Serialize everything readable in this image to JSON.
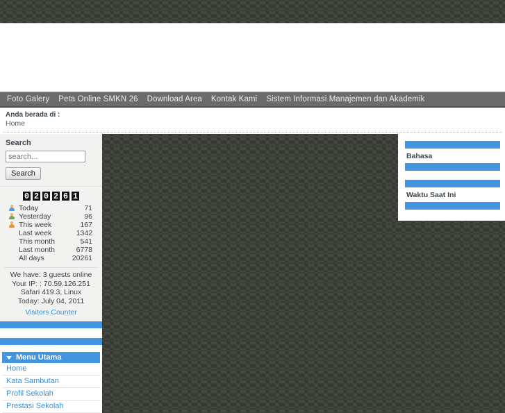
{
  "site": {
    "background_color": "#3b3e37",
    "accent_color": "#4295dd",
    "link_color": "#3d8fd1"
  },
  "topnav": {
    "items": [
      {
        "label": "Foto Galery"
      },
      {
        "label": "Peta Online SMKN 26"
      },
      {
        "label": "Download Area"
      },
      {
        "label": "Kontak Kami"
      },
      {
        "label": "Sistem Informasi Manajemen dan Akademik"
      }
    ]
  },
  "breadcrumb": {
    "title": "Anda berada di :",
    "path": "Home"
  },
  "search": {
    "label": "Search",
    "placeholder": "search...",
    "value": "",
    "button_label": "Search"
  },
  "counter": {
    "digits": [
      "0",
      "2",
      "0",
      "2",
      "6",
      "1"
    ],
    "stats": [
      {
        "icon": "person-icon-blue",
        "color": "#5b9bd5",
        "label": "Today",
        "value": "71"
      },
      {
        "icon": "person-icon-green",
        "color": "#6aa84f",
        "label": "Yesterday",
        "value": "96"
      },
      {
        "icon": "person-icon-orange",
        "color": "#e8922a",
        "label": "This week",
        "value": "167"
      },
      {
        "icon": "",
        "color": "",
        "label": "Last week",
        "value": "1342"
      },
      {
        "icon": "",
        "color": "",
        "label": "This month",
        "value": "541"
      },
      {
        "icon": "",
        "color": "",
        "label": "Last month",
        "value": "6778"
      },
      {
        "icon": "",
        "color": "",
        "label": "All days",
        "value": "20261"
      }
    ],
    "info": {
      "guests": "We have: 3 guests online",
      "ip": "Your IP: : 70.59.126.251",
      "agent": "Safari 419.3, Linux",
      "today": "Today: July 04, 2011"
    },
    "link_label": "Visitors Counter"
  },
  "mainmenu": {
    "title": "Menu Utama",
    "items": [
      {
        "label": "Home"
      },
      {
        "label": "Kata Sambutan"
      },
      {
        "label": "Profil Sekolah"
      },
      {
        "label": "Prestasi Sekolah"
      }
    ]
  },
  "rightcol": {
    "modules": [
      {
        "title": "Bahasa"
      },
      {
        "title": "Waktu Saat Ini"
      }
    ]
  }
}
